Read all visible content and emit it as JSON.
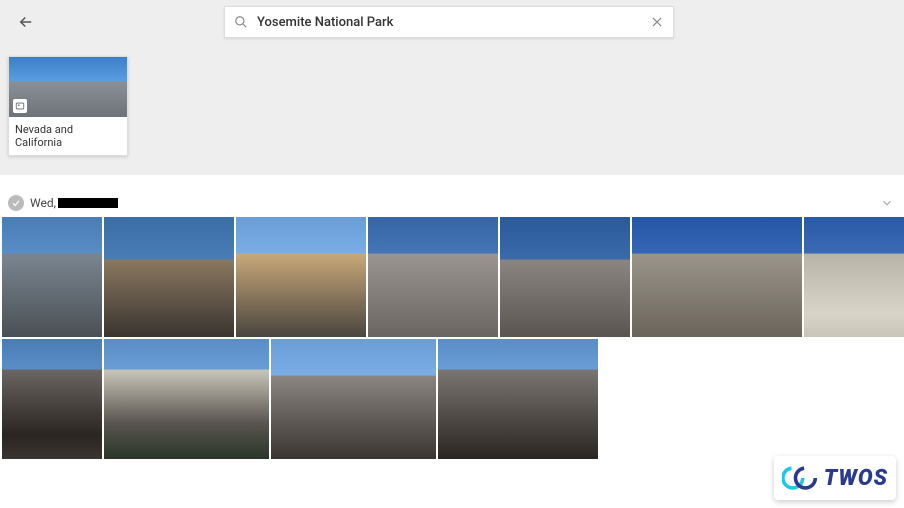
{
  "search": {
    "query": "Yosemite National Park"
  },
  "album": {
    "title": "Nevada and California"
  },
  "group": {
    "day_prefix": "Wed,"
  },
  "watermark": {
    "text": "TWOS"
  }
}
